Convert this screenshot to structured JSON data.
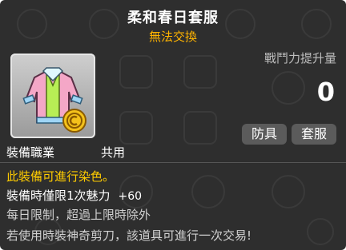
{
  "item": {
    "name": "柔和春日套服",
    "trade_status": "無法交換"
  },
  "stats": {
    "power_label": "戰鬥力提升量",
    "power_value": "0"
  },
  "tags": {
    "armor": "防具",
    "cash": "套服"
  },
  "job": {
    "label": "裝備職業",
    "value": "共用"
  },
  "description": {
    "dye": "此裝備可進行染色。",
    "charm_text": "裝備時僅限1次魅力",
    "charm_bonus": "+60",
    "daily_limit": "每日限制，超過上限時除外",
    "scissors": "若使用時裝神奇剪刀，該道具可進行一次交易!"
  },
  "icon": "pastel-jacket-icon",
  "colors": {
    "title": "#ffffff",
    "trade_status": "#ffb400",
    "dye_note": "#ffcc00",
    "panel_bg": "#2e2e2e"
  }
}
